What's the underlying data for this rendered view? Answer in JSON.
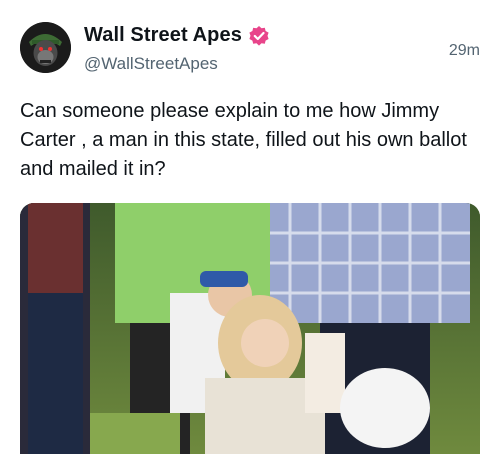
{
  "author": {
    "display_name": "Wall Street Apes",
    "handle": "@WallStreetApes",
    "avatar_icon": "gorilla-avatar-icon",
    "verified_icon": "verified-badge-icon",
    "verified_color": "#e8448a"
  },
  "timestamp": "29m",
  "tweet": {
    "text": "Can someone please explain to me how Jimmy Carter , a man in this state, filled out his own ballot and mailed it in?"
  },
  "media": {
    "type": "video-frame"
  }
}
